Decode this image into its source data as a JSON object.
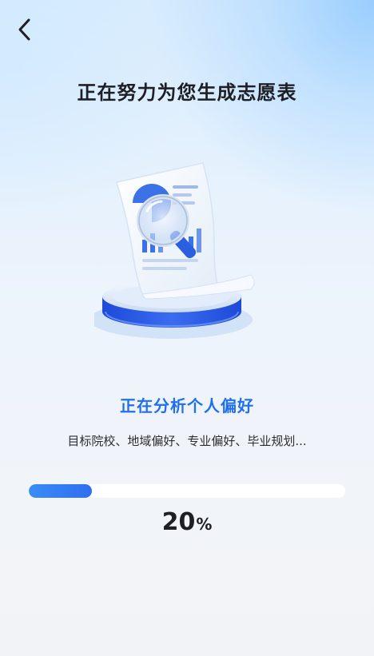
{
  "header": {
    "back_icon": "chevron-left-icon",
    "title": "正在努力为您生成志愿表"
  },
  "illustration": {
    "icon": "document-magnifier-illustration"
  },
  "status": {
    "title": "正在分析个人偏好",
    "description": "目标院校、地域偏好、专业偏好、毕业规划..."
  },
  "progress": {
    "value": "20",
    "unit": "%",
    "fraction": 0.2
  },
  "colors": {
    "accent": "#2f6ff0",
    "title_text": "#1d1f24",
    "status_text": "#1f6ff0"
  }
}
